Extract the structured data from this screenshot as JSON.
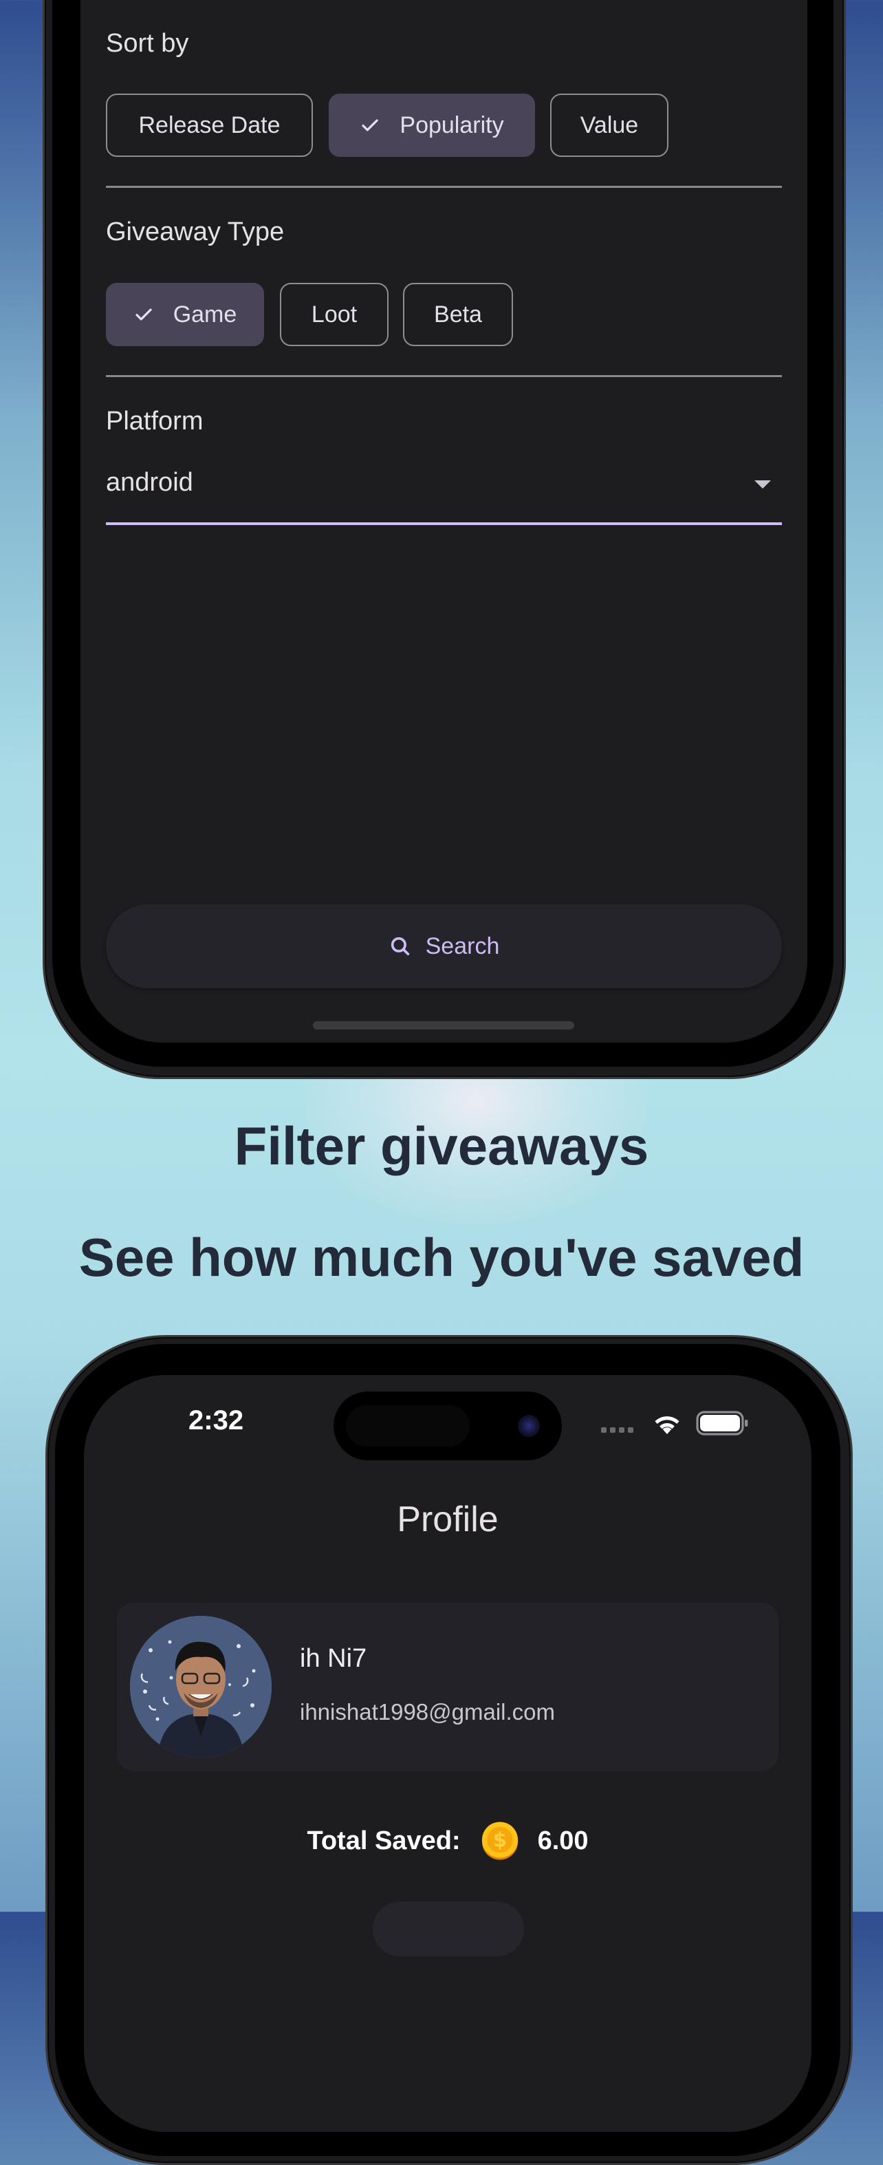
{
  "filter_screen": {
    "sort_by": {
      "label": "Sort by",
      "options": [
        {
          "label": "Release Date",
          "selected": false
        },
        {
          "label": "Popularity",
          "selected": true
        },
        {
          "label": "Value",
          "selected": false
        }
      ]
    },
    "giveaway_type": {
      "label": "Giveaway Type",
      "options": [
        {
          "label": "Game",
          "selected": true
        },
        {
          "label": "Loot",
          "selected": false
        },
        {
          "label": "Beta",
          "selected": false
        }
      ]
    },
    "platform": {
      "label": "Platform",
      "value": "android",
      "icon": "dropdown-arrow-icon"
    },
    "search_button": {
      "label": "Search",
      "icon": "search-icon"
    }
  },
  "captions": {
    "filter": "Filter giveaways",
    "saved": "See how much you've saved"
  },
  "profile_screen": {
    "status_bar": {
      "time": "2:32",
      "icons": [
        "signal-icon",
        "wifi-icon",
        "battery-icon"
      ]
    },
    "title": "Profile",
    "user": {
      "name": "ih Ni7",
      "email": "ihnishat1998@gmail.com",
      "avatar": "avatar-photo"
    },
    "total_saved": {
      "label": "Total Saved:",
      "icon": "coin-icon",
      "value": "6.00"
    }
  },
  "colors": {
    "screen_bg": "#1d1d20",
    "chip_selected_bg": "#4a4458",
    "accent": "#cfbcff",
    "search_text": "#cdbdf5",
    "caption_text": "#232b3a",
    "coin": "#f5a80c"
  }
}
